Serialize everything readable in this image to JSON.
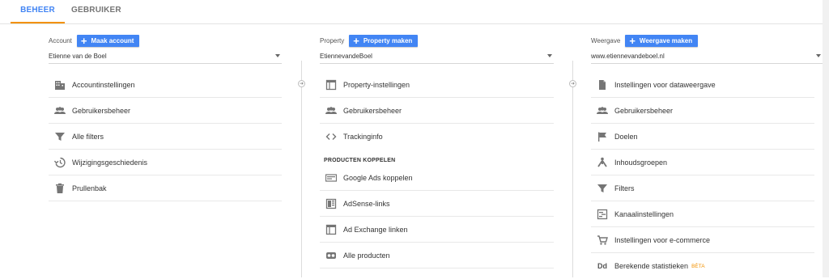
{
  "tabs": {
    "beheer": "BEHEER",
    "gebruiker": "GEBRUIKER"
  },
  "account": {
    "label": "Account",
    "button": "Maak account",
    "selected": "Etienne van de Boel",
    "items": [
      "Accountinstellingen",
      "Gebruikersbeheer",
      "Alle filters",
      "Wijzigingsgeschiedenis",
      "Prullenbak"
    ]
  },
  "property": {
    "label": "Property",
    "button": "Property maken",
    "selected": "EtiennevandeBoel",
    "items": [
      "Property-instellingen",
      "Gebruikersbeheer",
      "Trackinginfo"
    ],
    "section": "PRODUCTEN KOPPELEN",
    "linked": [
      "Google Ads koppelen",
      "AdSense-links",
      "Ad Exchange linken",
      "Alle producten"
    ]
  },
  "view": {
    "label": "Weergave",
    "button": "Weergave maken",
    "selected": "www.etiennevandeboel.nl",
    "items": [
      "Instellingen voor dataweergave",
      "Gebruikersbeheer",
      "Doelen",
      "Inhoudsgroepen",
      "Filters",
      "Kanaalinstellingen",
      "Instellingen voor e-commerce",
      "Berekende statistieken"
    ],
    "beta": "BÈTA"
  },
  "colors": {
    "accent": "#4285f4",
    "tab_indicator": "#f29100",
    "icon": "#757575"
  }
}
